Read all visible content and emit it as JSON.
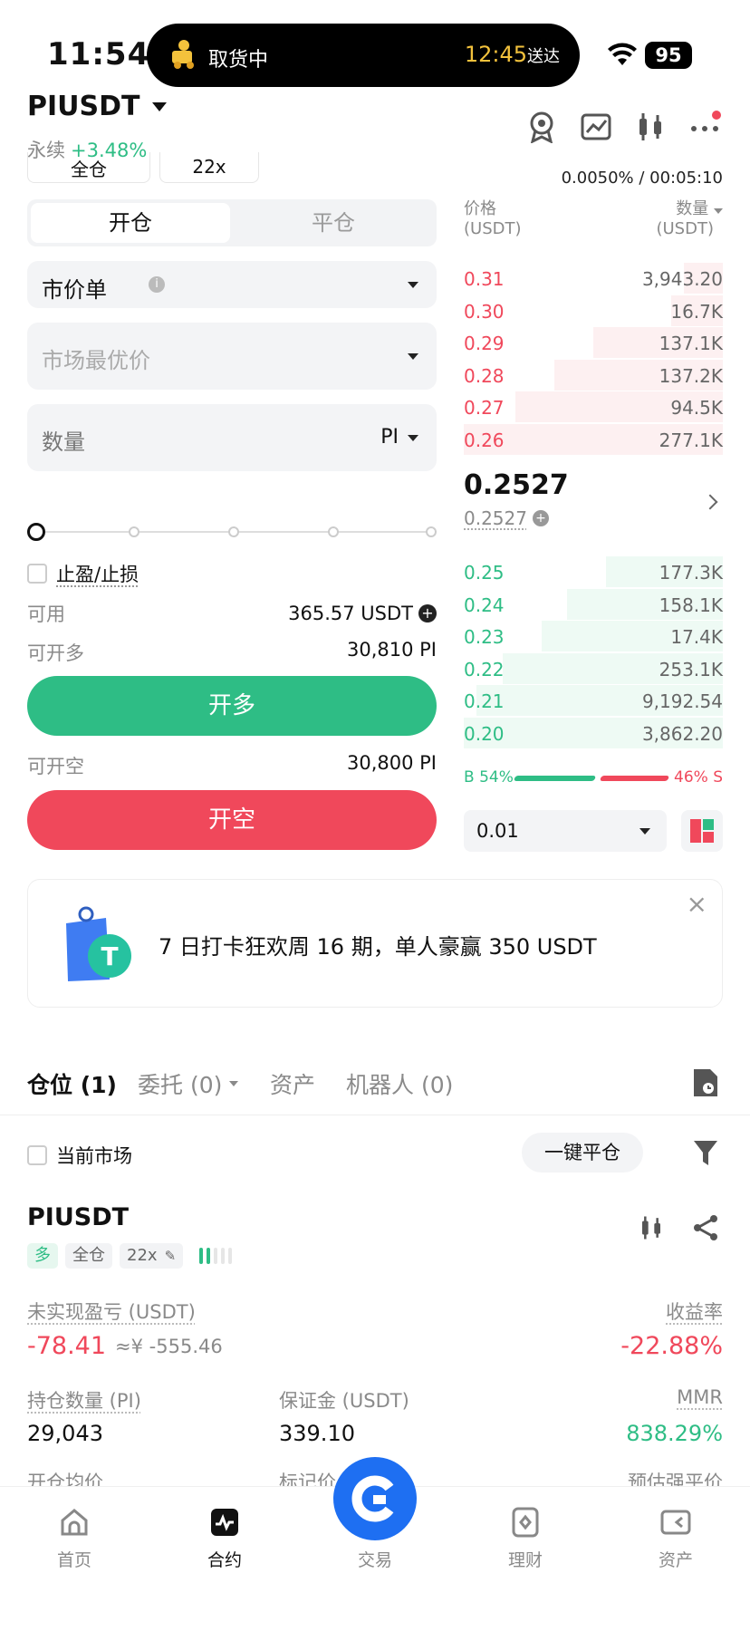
{
  "status_bar": {
    "time": "11:54",
    "island_title": "取货中",
    "island_eta_time": "12:45",
    "island_eta_suffix": "送达",
    "battery": "95"
  },
  "header": {
    "pair": "PIUSDT",
    "contract_type": "永续",
    "change": "+3.48%",
    "margin_mode": "全仓",
    "leverage": "22x",
    "funding": "0.0050% / 00:05:10"
  },
  "order_form": {
    "tab_open": "开仓",
    "tab_close": "平仓",
    "order_type": "市价单",
    "price_placeholder": "市场最优价",
    "qty_placeholder": "数量",
    "qty_unit": "PI",
    "tpsl_label": "止盈/止损",
    "available_label": "可用",
    "available_value": "365.57 USDT",
    "can_long_label": "可开多",
    "can_long_value": "30,810 PI",
    "long_button": "开多",
    "can_short_label": "可开空",
    "can_short_value": "30,800 PI",
    "short_button": "开空",
    "slider_level": 0
  },
  "order_book": {
    "price_header": "价格",
    "price_unit": "(USDT)",
    "qty_header": "数量",
    "qty_unit": "(USDT)",
    "asks": [
      {
        "price": "0.31",
        "qty": "3,943.20",
        "depth": 0.15
      },
      {
        "price": "0.30",
        "qty": "16.7K",
        "depth": 0.2
      },
      {
        "price": "0.29",
        "qty": "137.1K",
        "depth": 0.5
      },
      {
        "price": "0.28",
        "qty": "137.2K",
        "depth": 0.65
      },
      {
        "price": "0.27",
        "qty": "94.5K",
        "depth": 0.8
      },
      {
        "price": "0.26",
        "qty": "277.1K",
        "depth": 1.0
      }
    ],
    "last_price": "0.2527",
    "mark_price": "0.2527",
    "bids": [
      {
        "price": "0.25",
        "qty": "177.3K",
        "depth": 0.45
      },
      {
        "price": "0.24",
        "qty": "158.1K",
        "depth": 0.6
      },
      {
        "price": "0.23",
        "qty": "17.4K",
        "depth": 0.7
      },
      {
        "price": "0.22",
        "qty": "253.1K",
        "depth": 0.85
      },
      {
        "price": "0.21",
        "qty": "9,192.54",
        "depth": 0.95
      },
      {
        "price": "0.20",
        "qty": "3,862.20",
        "depth": 1.0
      }
    ],
    "buy_ratio": "B 54%",
    "sell_ratio": "46% S",
    "buy_fraction": 0.54,
    "precision": "0.01"
  },
  "banner": {
    "text": "7 日打卡狂欢周 16 期，单人豪赢 350 USDT"
  },
  "tabs": {
    "positions": "仓位",
    "positions_count": "(1)",
    "orders": "委托 (0)",
    "assets": "资产",
    "bots": "机器人 (0)"
  },
  "filter": {
    "current_market": "当前市场",
    "close_all": "一键平仓"
  },
  "position": {
    "symbol": "PIUSDT",
    "side": "多",
    "mode": "全仓",
    "leverage": "22x",
    "pnl_label": "未实现盈亏 (USDT)",
    "pnl": "-78.41",
    "pnl_cny": "≈¥ -555.46",
    "roe_label": "收益率",
    "roe": "-22.88%",
    "size_label": "持仓数量 (PI)",
    "size": "29,043",
    "margin_label": "保证金 (USDT)",
    "margin": "339.10",
    "mmr_label": "MMR",
    "mmr": "838.29%",
    "entry_label": "开仓均价",
    "mark_label": "标记价",
    "liq_label": "预估强平价"
  },
  "nav": {
    "home": "首页",
    "futures": "合约",
    "trade": "交易",
    "earn": "理财",
    "assets": "资产"
  },
  "colors": {
    "green": "#2ebd85",
    "red": "#f0485b",
    "brand_blue": "#1e6ff2"
  }
}
